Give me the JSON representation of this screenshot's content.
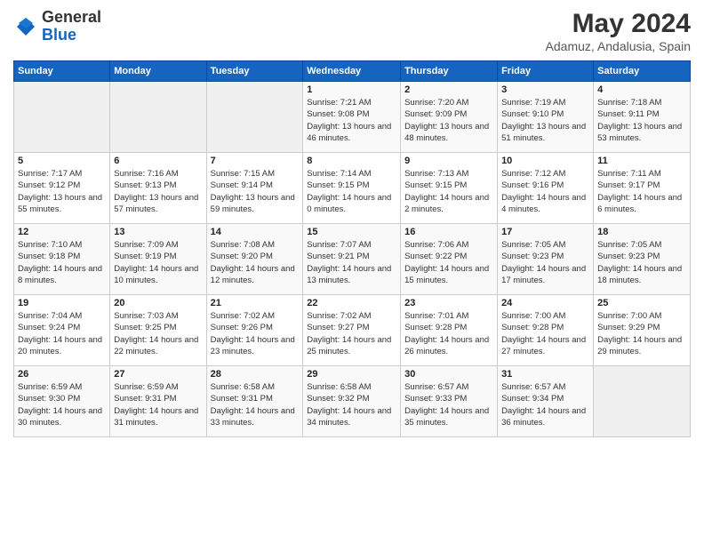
{
  "header": {
    "logo_general": "General",
    "logo_blue": "Blue",
    "month_year": "May 2024",
    "location": "Adamuz, Andalusia, Spain"
  },
  "days_of_week": [
    "Sunday",
    "Monday",
    "Tuesday",
    "Wednesday",
    "Thursday",
    "Friday",
    "Saturday"
  ],
  "weeks": [
    [
      {
        "day": "",
        "info": ""
      },
      {
        "day": "",
        "info": ""
      },
      {
        "day": "",
        "info": ""
      },
      {
        "day": "1",
        "info": "Sunrise: 7:21 AM\nSunset: 9:08 PM\nDaylight: 13 hours and 46 minutes."
      },
      {
        "day": "2",
        "info": "Sunrise: 7:20 AM\nSunset: 9:09 PM\nDaylight: 13 hours and 48 minutes."
      },
      {
        "day": "3",
        "info": "Sunrise: 7:19 AM\nSunset: 9:10 PM\nDaylight: 13 hours and 51 minutes."
      },
      {
        "day": "4",
        "info": "Sunrise: 7:18 AM\nSunset: 9:11 PM\nDaylight: 13 hours and 53 minutes."
      }
    ],
    [
      {
        "day": "5",
        "info": "Sunrise: 7:17 AM\nSunset: 9:12 PM\nDaylight: 13 hours and 55 minutes."
      },
      {
        "day": "6",
        "info": "Sunrise: 7:16 AM\nSunset: 9:13 PM\nDaylight: 13 hours and 57 minutes."
      },
      {
        "day": "7",
        "info": "Sunrise: 7:15 AM\nSunset: 9:14 PM\nDaylight: 13 hours and 59 minutes."
      },
      {
        "day": "8",
        "info": "Sunrise: 7:14 AM\nSunset: 9:15 PM\nDaylight: 14 hours and 0 minutes."
      },
      {
        "day": "9",
        "info": "Sunrise: 7:13 AM\nSunset: 9:15 PM\nDaylight: 14 hours and 2 minutes."
      },
      {
        "day": "10",
        "info": "Sunrise: 7:12 AM\nSunset: 9:16 PM\nDaylight: 14 hours and 4 minutes."
      },
      {
        "day": "11",
        "info": "Sunrise: 7:11 AM\nSunset: 9:17 PM\nDaylight: 14 hours and 6 minutes."
      }
    ],
    [
      {
        "day": "12",
        "info": "Sunrise: 7:10 AM\nSunset: 9:18 PM\nDaylight: 14 hours and 8 minutes."
      },
      {
        "day": "13",
        "info": "Sunrise: 7:09 AM\nSunset: 9:19 PM\nDaylight: 14 hours and 10 minutes."
      },
      {
        "day": "14",
        "info": "Sunrise: 7:08 AM\nSunset: 9:20 PM\nDaylight: 14 hours and 12 minutes."
      },
      {
        "day": "15",
        "info": "Sunrise: 7:07 AM\nSunset: 9:21 PM\nDaylight: 14 hours and 13 minutes."
      },
      {
        "day": "16",
        "info": "Sunrise: 7:06 AM\nSunset: 9:22 PM\nDaylight: 14 hours and 15 minutes."
      },
      {
        "day": "17",
        "info": "Sunrise: 7:05 AM\nSunset: 9:23 PM\nDaylight: 14 hours and 17 minutes."
      },
      {
        "day": "18",
        "info": "Sunrise: 7:05 AM\nSunset: 9:23 PM\nDaylight: 14 hours and 18 minutes."
      }
    ],
    [
      {
        "day": "19",
        "info": "Sunrise: 7:04 AM\nSunset: 9:24 PM\nDaylight: 14 hours and 20 minutes."
      },
      {
        "day": "20",
        "info": "Sunrise: 7:03 AM\nSunset: 9:25 PM\nDaylight: 14 hours and 22 minutes."
      },
      {
        "day": "21",
        "info": "Sunrise: 7:02 AM\nSunset: 9:26 PM\nDaylight: 14 hours and 23 minutes."
      },
      {
        "day": "22",
        "info": "Sunrise: 7:02 AM\nSunset: 9:27 PM\nDaylight: 14 hours and 25 minutes."
      },
      {
        "day": "23",
        "info": "Sunrise: 7:01 AM\nSunset: 9:28 PM\nDaylight: 14 hours and 26 minutes."
      },
      {
        "day": "24",
        "info": "Sunrise: 7:00 AM\nSunset: 9:28 PM\nDaylight: 14 hours and 27 minutes."
      },
      {
        "day": "25",
        "info": "Sunrise: 7:00 AM\nSunset: 9:29 PM\nDaylight: 14 hours and 29 minutes."
      }
    ],
    [
      {
        "day": "26",
        "info": "Sunrise: 6:59 AM\nSunset: 9:30 PM\nDaylight: 14 hours and 30 minutes."
      },
      {
        "day": "27",
        "info": "Sunrise: 6:59 AM\nSunset: 9:31 PM\nDaylight: 14 hours and 31 minutes."
      },
      {
        "day": "28",
        "info": "Sunrise: 6:58 AM\nSunset: 9:31 PM\nDaylight: 14 hours and 33 minutes."
      },
      {
        "day": "29",
        "info": "Sunrise: 6:58 AM\nSunset: 9:32 PM\nDaylight: 14 hours and 34 minutes."
      },
      {
        "day": "30",
        "info": "Sunrise: 6:57 AM\nSunset: 9:33 PM\nDaylight: 14 hours and 35 minutes."
      },
      {
        "day": "31",
        "info": "Sunrise: 6:57 AM\nSunset: 9:34 PM\nDaylight: 14 hours and 36 minutes."
      },
      {
        "day": "",
        "info": ""
      }
    ]
  ]
}
